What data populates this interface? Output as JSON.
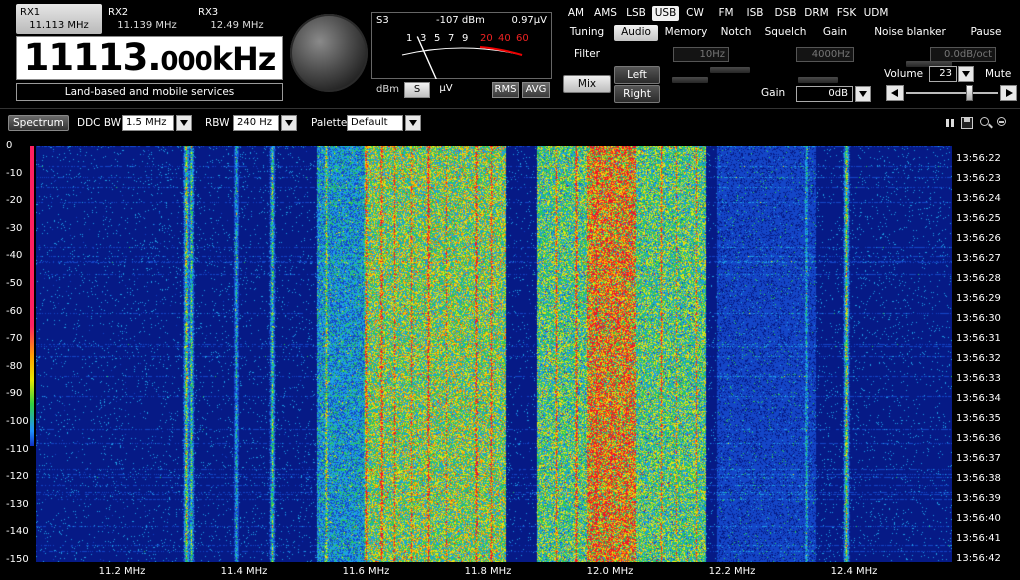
{
  "receivers": [
    {
      "name": "RX1",
      "freq": "11.113 MHz",
      "active": true
    },
    {
      "name": "RX2",
      "freq": "11.139 MHz",
      "active": false
    },
    {
      "name": "RX3",
      "freq": "12.49 MHz",
      "active": false
    }
  ],
  "frequency": {
    "main": "11113.",
    "decimals": "000",
    "unit": "kHz"
  },
  "service": "Land-based and mobile services",
  "meter": {
    "s_reading": "S3",
    "dbm_reading": "-107 dBm",
    "uv_reading": "0.97µV",
    "scale_white": [
      "1",
      "3",
      "5",
      "7",
      "9"
    ],
    "scale_red": [
      "20",
      "40",
      "60"
    ],
    "needle_fraction": 0.3,
    "buttons": {
      "dbm": "dBm",
      "s": "S",
      "uv": "µV",
      "rms": "RMS",
      "avg": "AVG"
    }
  },
  "modes": [
    "AM",
    "AMS",
    "LSB",
    "USB",
    "CW",
    "FM",
    "ISB",
    "DSB",
    "DRM",
    "FSK",
    "UDM"
  ],
  "active_mode": "USB",
  "control_tabs": [
    "Tuning",
    "Audio",
    "Memory",
    "Notch",
    "Squelch",
    "Gain",
    "Noise blanker",
    "Pause"
  ],
  "active_tab": "Audio",
  "audio": {
    "filter_label": "Filter",
    "mix_label": "Mix",
    "left_label": "Left",
    "right_label": "Right",
    "low_cut": "10Hz",
    "high_cut": "4000Hz",
    "slope": "0.0dB/oct",
    "gain_label": "Gain",
    "gain_value": "0dB",
    "volume_label": "Volume",
    "volume_value": "23",
    "mute_label": "Mute"
  },
  "toolbar": {
    "spectrum_label": "Spectrum",
    "ddc_label": "DDC BW",
    "ddc_value": "1.5 MHz",
    "rbw_label": "RBW",
    "rbw_value": "240 Hz",
    "palette_label": "Palette",
    "palette_value": "Default"
  },
  "waterfall": {
    "y_labels": [
      "0",
      "-10",
      "-20",
      "-30",
      "-40",
      "-50",
      "-60",
      "-70",
      "-80",
      "-90",
      "-100",
      "-110",
      "-120",
      "-130",
      "-140",
      "-150"
    ],
    "timestamps": [
      "13:56:22",
      "13:56:23",
      "13:56:24",
      "13:56:25",
      "13:56:26",
      "13:56:27",
      "13:56:28",
      "13:56:29",
      "13:56:30",
      "13:56:31",
      "13:56:32",
      "13:56:33",
      "13:56:34",
      "13:56:35",
      "13:56:36",
      "13:56:37",
      "13:56:38",
      "13:56:39",
      "13:56:40",
      "13:56:41",
      "13:56:42"
    ],
    "x_labels": [
      "11.2 MHz",
      "11.4 MHz",
      "11.6 MHz",
      "11.8 MHz",
      "12.0 MHz",
      "12.2 MHz",
      "12.4 MHz"
    ]
  },
  "colors": {
    "waterfall_bg": "#061a86",
    "accent_text": "#ffffff"
  }
}
